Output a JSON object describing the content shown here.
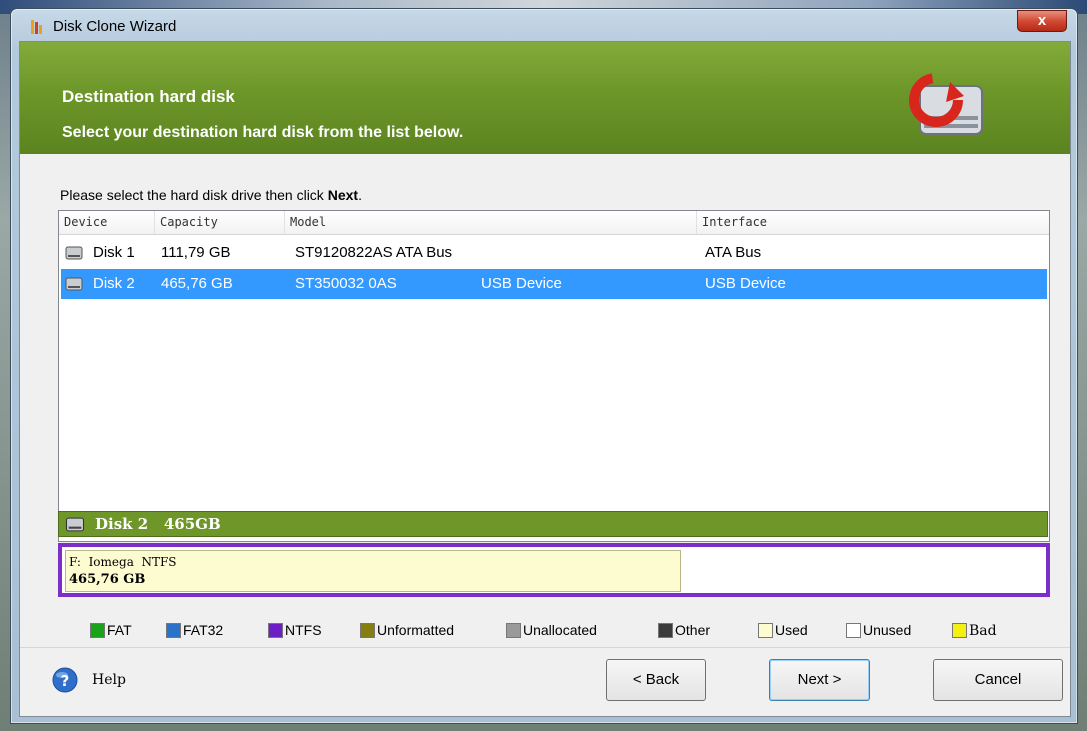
{
  "window": {
    "title": "Disk Clone Wizard",
    "close_label": "x"
  },
  "header": {
    "title": "Destination hard disk",
    "subtitle": "Select your destination hard disk from the list below."
  },
  "instruction": {
    "prefix": "Please select the hard disk drive then click ",
    "emphasis": "Next",
    "suffix": "."
  },
  "disk_list": {
    "columns": [
      "Device",
      "Capacity",
      "Model",
      "Interface"
    ],
    "rows": [
      {
        "device": "Disk 1",
        "capacity": "111,79 GB",
        "model": "ST9120822AS ATA Bus",
        "model_extra": "",
        "interface": "ATA Bus",
        "selected": false
      },
      {
        "device": "Disk 2",
        "capacity": "465,76 GB",
        "model": "ST350032 0AS",
        "model_extra": "USB Device",
        "interface": "USB Device",
        "selected": true
      }
    ]
  },
  "disk_bar": {
    "label": "Disk 2",
    "size": "465GB"
  },
  "partition": {
    "line1": "F:  Iomega  NTFS",
    "line2": "465,76 GB",
    "used_fraction": 0.63
  },
  "legend": [
    {
      "label": "FAT",
      "color": "#1aa31a"
    },
    {
      "label": "FAT32",
      "color": "#2a73c8"
    },
    {
      "label": "NTFS",
      "color": "#6b1fc4"
    },
    {
      "label": "Unformatted",
      "color": "#857e12"
    },
    {
      "label": "Unallocated",
      "color": "#9a9a9a"
    },
    {
      "label": "Other",
      "color": "#3b3b3b"
    },
    {
      "label": "Used",
      "color": "#fdfbd0"
    },
    {
      "label": "Unused",
      "color": "#ffffff"
    },
    {
      "label": "Bad",
      "color": "#f4f013"
    }
  ],
  "footer": {
    "help_label": "Help",
    "back_label": "< Back",
    "next_label": "Next >",
    "cancel_label": "Cancel"
  },
  "colors": {
    "header_green": "#6d9629",
    "selection_blue": "#3399ff",
    "ntfs_border": "#7c2fc8"
  }
}
